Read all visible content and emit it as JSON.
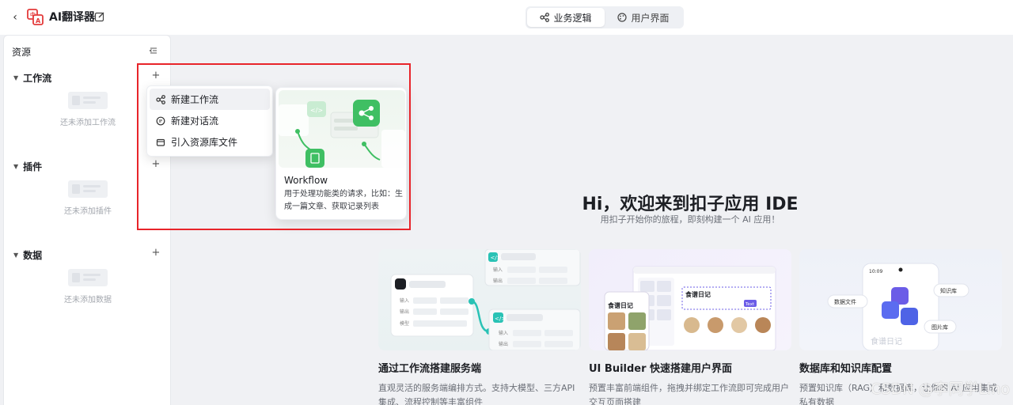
{
  "app": {
    "title": "AI翻译器"
  },
  "tabs": [
    {
      "label": "业务逻辑",
      "active": true
    },
    {
      "label": "用户界面",
      "active": false
    }
  ],
  "sidebar": {
    "title": "资源",
    "sections": [
      {
        "title": "工作流",
        "empty_text": "还未添加工作流"
      },
      {
        "title": "插件",
        "empty_text": "还未添加插件"
      },
      {
        "title": "数据",
        "empty_text": "还未添加数据"
      }
    ]
  },
  "menu": {
    "items": [
      {
        "label": "新建工作流",
        "icon": "workflow-icon"
      },
      {
        "label": "新建对话流",
        "icon": "chatflow-icon"
      },
      {
        "label": "引入资源库文件",
        "icon": "library-icon"
      }
    ]
  },
  "preview": {
    "title": "Workflow",
    "description": "用于处理功能类的请求，比如：生成一篇文章、获取记录列表"
  },
  "welcome": {
    "title": "Hi，欢迎来到扣子应用 IDE",
    "subtitle": "用扣子开始你的旅程，即刻构建一个 AI 应用！"
  },
  "cards": [
    {
      "title": "通过工作流搭建服务端",
      "description": "直观灵活的服务端编排方式。支持大模型、三方API集成、流程控制等丰富组件",
      "illustration": {
        "labels": [
          "输入",
          "输出",
          "模型",
          "输入",
          "输出"
        ]
      }
    },
    {
      "title": "UI Builder 快速搭建用户界面",
      "description": "预置丰富前端组件，拖拽并绑定工作流即可完成用户交互页面搭建",
      "illustration": {
        "labels": [
          "食谱日记",
          "食谱日记",
          "Text"
        ]
      }
    },
    {
      "title": "数据库和知识库配置",
      "description": "预置知识库（RAG）和数据库，让你的 AI 应用集成私有数据",
      "illustration": {
        "labels": [
          "10:09",
          "数据文件",
          "知识库",
          "图片库",
          "食谱日记"
        ]
      }
    }
  ],
  "watermark": "CSDN @李同学Lino"
}
